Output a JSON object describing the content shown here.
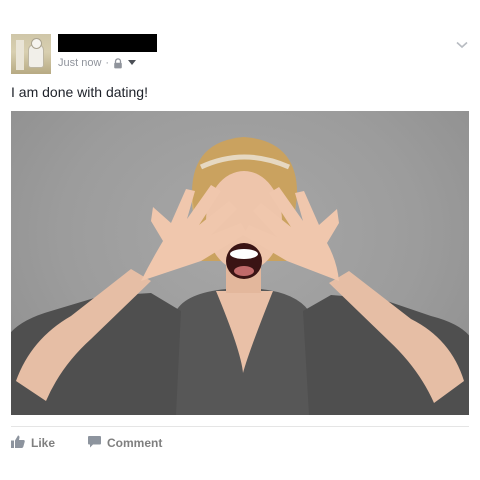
{
  "post": {
    "author_name": "",
    "timestamp": "Just now",
    "separator": "·",
    "privacy_icon": "lock-icon",
    "audience_caret_icon": "caret-down-icon",
    "options_caret_icon": "chevron-down-icon",
    "status_text": "I am done with dating!",
    "actions": {
      "like_label": "Like",
      "comment_label": "Comment"
    }
  }
}
